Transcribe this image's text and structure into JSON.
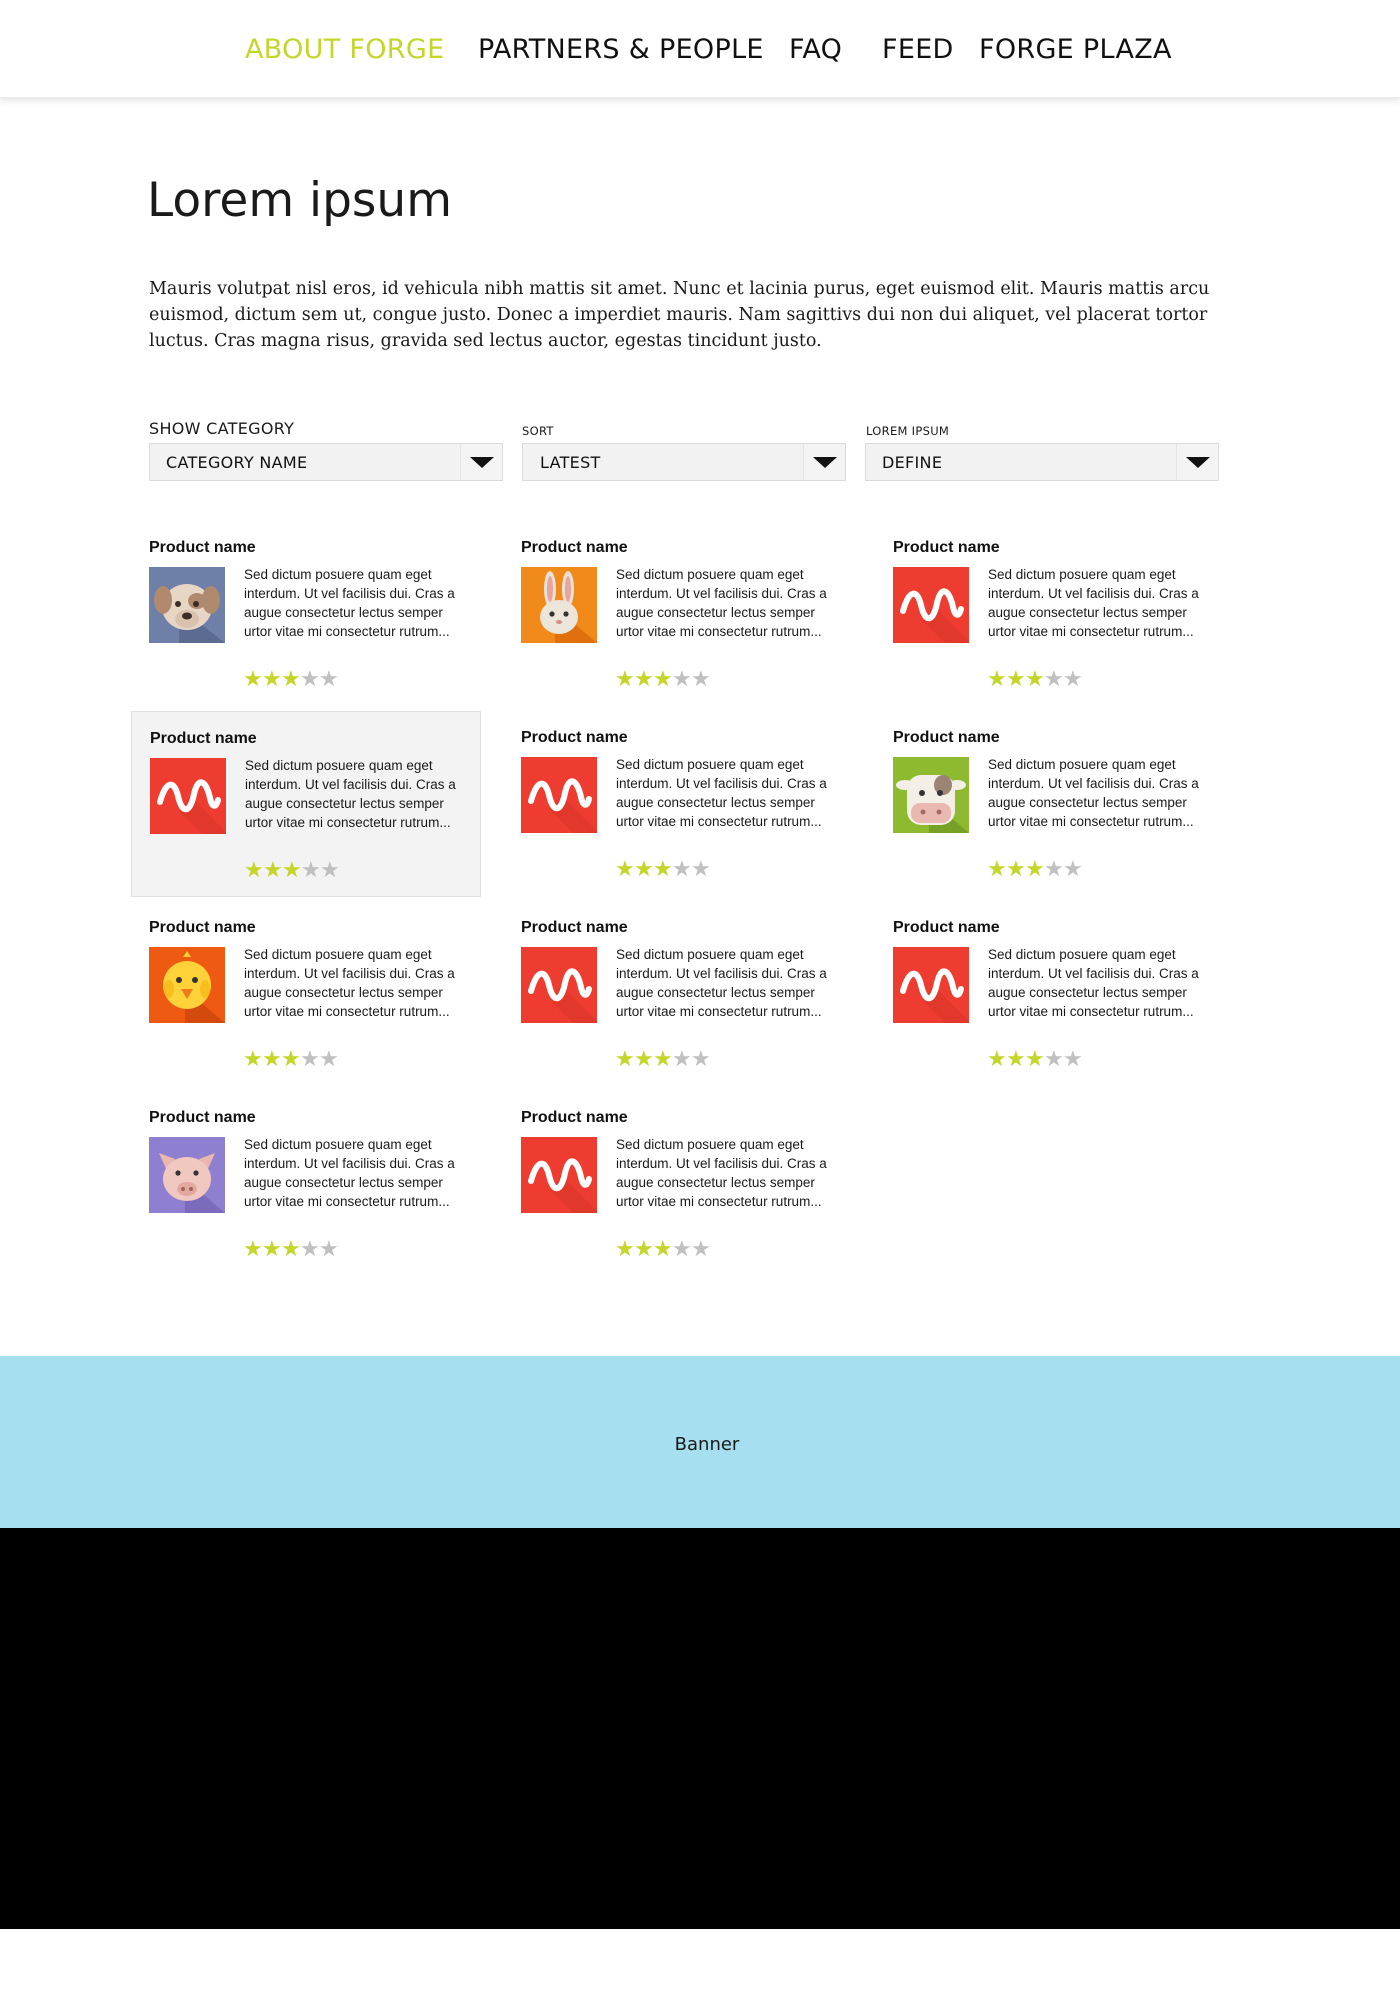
{
  "nav": {
    "items": [
      {
        "label": "ABOUT FORGE",
        "active": true
      },
      {
        "label": "PARTNERS & PEOPLE",
        "active": false
      },
      {
        "label": "FAQ",
        "active": false
      },
      {
        "label": "FEED",
        "active": false
      },
      {
        "label": "FORGE PLAZA",
        "active": false
      }
    ]
  },
  "page": {
    "title": "Lorem ipsum",
    "intro": "Mauris volutpat nisl eros, id vehicula nibh mattis sit amet. Nunc et lacinia purus, eget euismod elit. Mauris mattis arcu euismod, dictum sem ut, congue justo. Donec a imperdiet mauris. Nam sagittivs dui non dui aliquet, vel placerat tortor luctus. Cras magna risus, gravida sed lectus auctor, egestas tincidunt justo."
  },
  "filters": {
    "category": {
      "label": "SHOW CATEGORY",
      "value": "CATEGORY NAME"
    },
    "sort": {
      "label": "SORT",
      "value": "LATEST"
    },
    "define": {
      "label": "LOREM IPSUM",
      "value": "DEFINE"
    }
  },
  "products": [
    {
      "name": "Product name",
      "icon": "dog-icon",
      "rating": 3,
      "max_rating": 5,
      "description": "Sed dictum posuere quam eget interdum. Ut vel facilisis dui. Cras a augue consectetur lectus semper urtor vitae mi consectetur rutrum..."
    },
    {
      "name": "Product name",
      "icon": "rabbit-icon",
      "rating": 3,
      "max_rating": 5,
      "description": "Sed dictum posuere quam eget interdum. Ut vel facilisis dui. Cras a augue consectetur lectus semper urtor vitae mi consectetur rutrum..."
    },
    {
      "name": "Product name",
      "icon": "wave-icon",
      "rating": 3,
      "max_rating": 5,
      "description": "Sed dictum posuere quam eget interdum. Ut vel facilisis dui. Cras a augue consectetur lectus semper urtor vitae mi consectetur rutrum..."
    },
    {
      "name": "Product name",
      "icon": "wave-icon",
      "rating": 3,
      "max_rating": 5,
      "description": "Sed dictum posuere quam eget interdum. Ut vel facilisis dui. Cras a augue consectetur lectus semper urtor vitae mi consectetur rutrum..."
    },
    {
      "name": "Product name",
      "icon": "wave-icon",
      "rating": 3,
      "max_rating": 5,
      "description": "Sed dictum posuere quam eget interdum. Ut vel facilisis dui. Cras a augue consectetur lectus semper urtor vitae mi consectetur rutrum..."
    },
    {
      "name": "Product name",
      "icon": "cow-icon",
      "rating": 3,
      "max_rating": 5,
      "description": "Sed dictum posuere quam eget interdum. Ut vel facilisis dui. Cras a augue consectetur lectus semper urtor vitae mi consectetur rutrum..."
    },
    {
      "name": "Product name",
      "icon": "chick-icon",
      "rating": 3,
      "max_rating": 5,
      "description": "Sed dictum posuere quam eget interdum. Ut vel facilisis dui. Cras a augue consectetur lectus semper urtor vitae mi consectetur rutrum..."
    },
    {
      "name": "Product name",
      "icon": "wave-icon",
      "rating": 3,
      "max_rating": 5,
      "description": "Sed dictum posuere quam eget interdum. Ut vel facilisis dui. Cras a augue consectetur lectus semper urtor vitae mi consectetur rutrum..."
    },
    {
      "name": "Product name",
      "icon": "wave-icon",
      "rating": 3,
      "max_rating": 5,
      "description": "Sed dictum posuere quam eget interdum. Ut vel facilisis dui. Cras a augue consectetur lectus semper urtor vitae mi consectetur rutrum..."
    },
    {
      "name": "Product name",
      "icon": "pig-icon",
      "rating": 3,
      "max_rating": 5,
      "description": "Sed dictum posuere quam eget interdum. Ut vel facilisis dui. Cras a augue consectetur lectus semper urtor vitae mi consectetur rutrum..."
    },
    {
      "name": "Product name",
      "icon": "wave-icon",
      "rating": 3,
      "max_rating": 5,
      "description": "Sed dictum posuere quam eget interdum. Ut vel facilisis dui. Cras a augue consectetur lectus semper urtor vitae mi consectetur rutrum..."
    }
  ],
  "banner": {
    "text": "Banner"
  },
  "colors": {
    "accent": "#c4d62a",
    "star_filled": "#c4d62a",
    "star_empty": "#c0c0c0",
    "banner_bg": "#a6dfef",
    "footer_bg": "#000000",
    "hover_card_bg": "#f3f3f3"
  }
}
